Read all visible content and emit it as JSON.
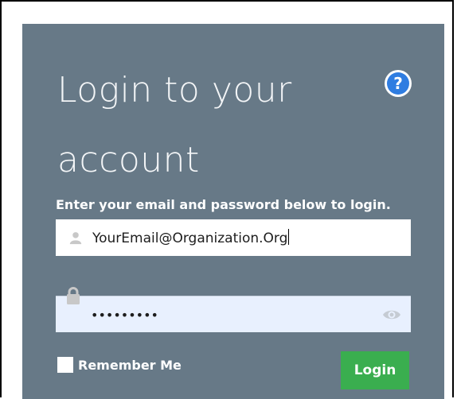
{
  "login": {
    "title": "Login to your account",
    "help_symbol": "?",
    "instructions": "Enter your email and password below to login.",
    "email": {
      "value": "YourEmail@Organization.Org",
      "icon": "user-icon"
    },
    "password": {
      "masked_value": "•••••••••",
      "icon": "lock-icon",
      "toggle_icon": "eye-icon"
    },
    "remember_label": "Remember Me",
    "remember_checked": false,
    "login_label": "Login"
  },
  "colors": {
    "panel": "#677987",
    "help": "#2f7de1",
    "login_button": "#3aae4f",
    "password_field": "#e8f0fe"
  }
}
